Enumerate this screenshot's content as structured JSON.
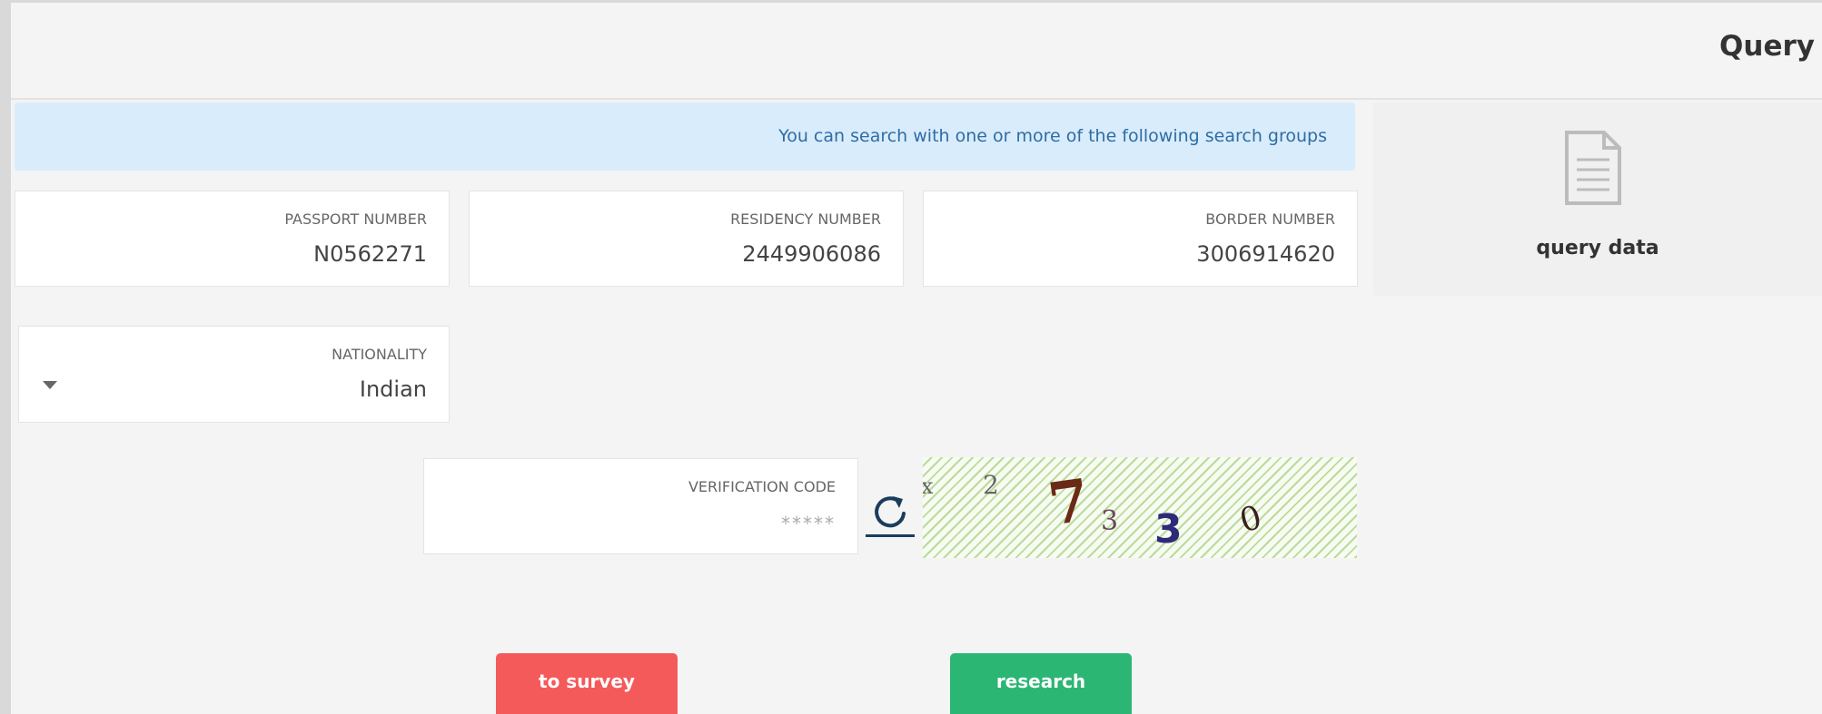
{
  "header": {
    "title": "Query"
  },
  "banner": {
    "text": "You can search with one or more of the following search groups"
  },
  "side_panel": {
    "icon": "document-icon",
    "label": "query data"
  },
  "fields": {
    "passport": {
      "label": "PASSPORT NUMBER",
      "value": "N0562271"
    },
    "residency": {
      "label": "RESIDENCY NUMBER",
      "value": "2449906086"
    },
    "border": {
      "label": "BORDER NUMBER",
      "value": "3006914620"
    },
    "nationality": {
      "label": "NATIONALITY",
      "value": "Indian"
    },
    "verification": {
      "label": "VERIFICATION CODE",
      "placeholder": "*****"
    }
  },
  "captcha": {
    "chars": [
      "x",
      "2",
      "7",
      "3",
      "3",
      "0"
    ]
  },
  "buttons": {
    "survey": "to survey",
    "research": "research"
  },
  "colors": {
    "banner_bg": "#d9ecfb",
    "banner_text": "#2e6da4",
    "survey_btn": "#f45a5a",
    "research_btn": "#2bb673"
  }
}
